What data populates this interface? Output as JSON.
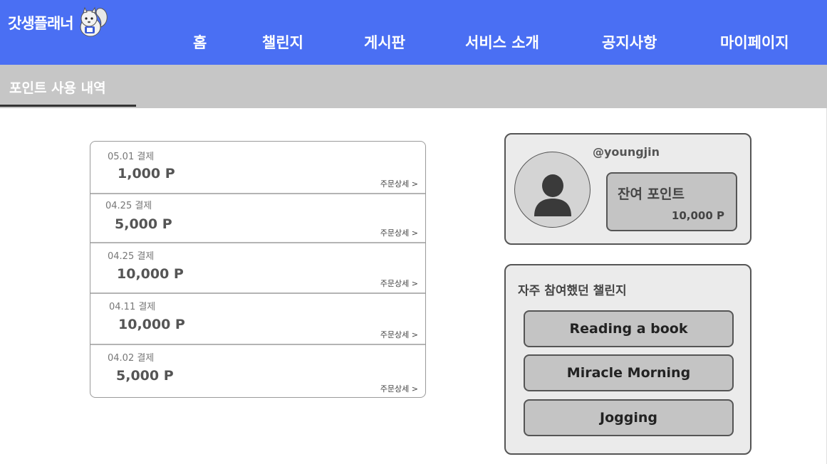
{
  "app": {
    "logo_text": "갓생플래너"
  },
  "nav": [
    {
      "label": "홈"
    },
    {
      "label": "챌린지"
    },
    {
      "label": "게시판"
    },
    {
      "label": "서비스 소개"
    },
    {
      "label": "공지사항"
    },
    {
      "label": "마이페이지"
    }
  ],
  "page": {
    "title": "포인트 사용 내역"
  },
  "history": {
    "detail_label": "주문상세 >",
    "items": [
      {
        "date": "05.01 결제",
        "amount": "1,000 P"
      },
      {
        "date": "04.25 결제",
        "amount": "5,000 P"
      },
      {
        "date": "04.25 결제",
        "amount": "10,000 P"
      },
      {
        "date": "04.11 결제",
        "amount": "10,000 P"
      },
      {
        "date": "04.02 결제",
        "amount": "5,000 P"
      }
    ]
  },
  "profile": {
    "username": "@youngjin",
    "points_label": "잔여 포인트",
    "points_value": "10,000 P"
  },
  "challenges": {
    "title": "자주 참여했던 챌린지",
    "items": [
      {
        "label": "Reading a book"
      },
      {
        "label": "Miracle Morning"
      },
      {
        "label": "Jogging"
      }
    ]
  },
  "colors": {
    "header_bg": "#4a6ff3",
    "subbar_bg": "#c6c6c6",
    "card_bg": "#ebebeb",
    "button_bg": "#c4c4c4"
  },
  "icons": [
    "squirrel-mascot-logo",
    "user-avatar-icon"
  ]
}
